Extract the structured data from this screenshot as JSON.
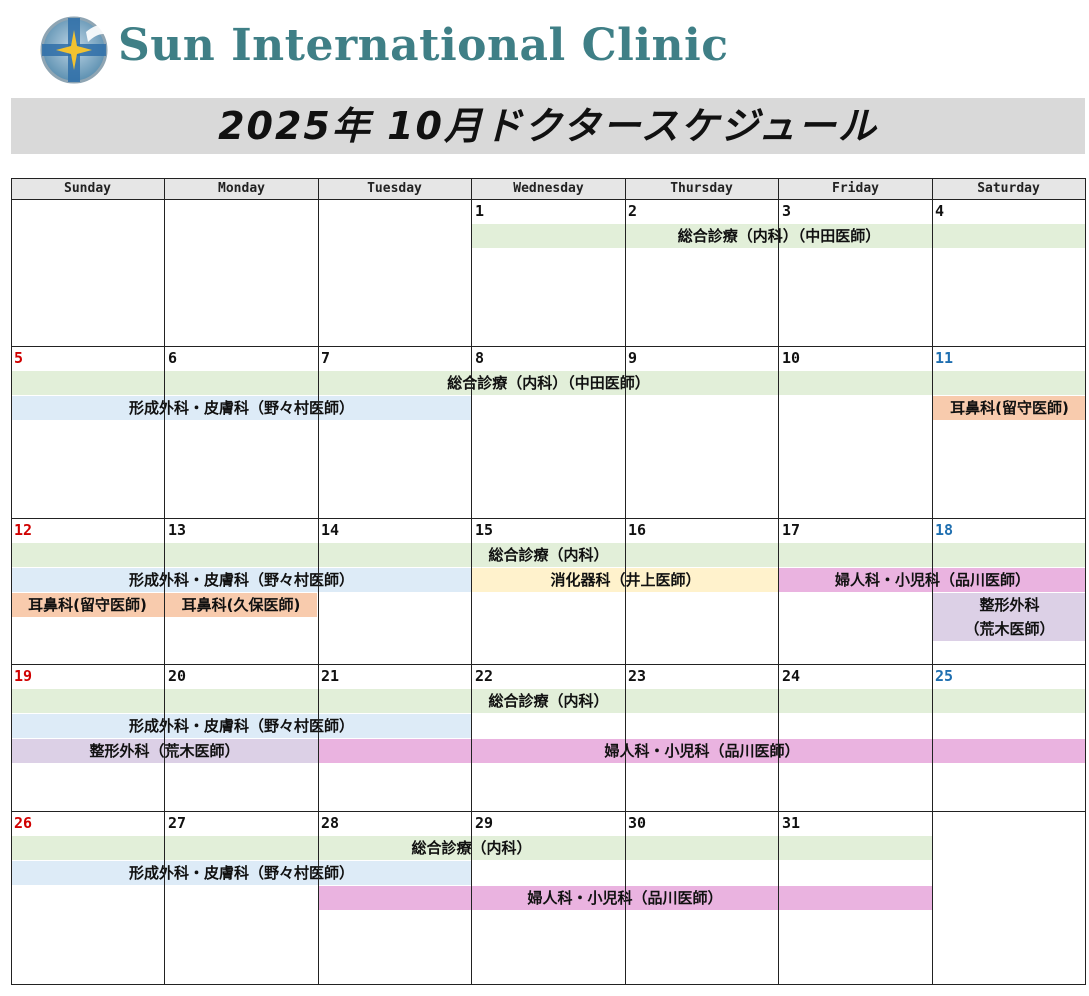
{
  "header": {
    "clinic_name": "Sun International Clinic",
    "logo_icon": "sun-star-logo-icon",
    "title": "2025年 10月ドクタースケジュール"
  },
  "calendar": {
    "weekdays": [
      "Sunday",
      "Monday",
      "Tuesday",
      "Wednesday",
      "Thursday",
      "Friday",
      "Saturday"
    ],
    "weeks": [
      [
        "",
        "",
        "",
        "1",
        "2",
        "3",
        "4"
      ],
      [
        "5",
        "6",
        "7",
        "8",
        "9",
        "10",
        "11"
      ],
      [
        "12",
        "13",
        "14",
        "15",
        "16",
        "17",
        "18"
      ],
      [
        "19",
        "20",
        "21",
        "22",
        "23",
        "24",
        "25"
      ],
      [
        "26",
        "27",
        "28",
        "29",
        "30",
        "31",
        ""
      ]
    ],
    "events": {
      "w1_general": "総合診療（内科）（中田医師）",
      "w2_general": "総合診療（内科）（中田医師）",
      "w2_plastic": "形成外科・皮膚科（野々村医師）",
      "w2_ent": "耳鼻科(留守医師)",
      "w3_general": "総合診療（内科）",
      "w3_plastic": "形成外科・皮膚科（野々村医師）",
      "w3_gastro": "消化器科（井上医師）",
      "w3_gyn": "婦人科・小児科（品川医師）",
      "w3_ent_sun": "耳鼻科(留守医師)",
      "w3_ent_mon": "耳鼻科(久保医師)",
      "w3_ortho_line1": "整形外科",
      "w3_ortho_line2": "（荒木医師）",
      "w4_general": "総合診療（内科）",
      "w4_plastic": "形成外科・皮膚科（野々村医師）",
      "w4_ortho": "整形外科（荒木医師）",
      "w4_gyn": "婦人科・小児科（品川医師）",
      "w5_general": "総合診療（内科）",
      "w5_plastic": "形成外科・皮膚科（野々村医師）",
      "w5_gyn": "婦人科・小児科（品川医師）"
    },
    "colors": {
      "general": "#e2efd9",
      "plastic": "#ddebf7",
      "ent": "#f8cbad",
      "gastro": "#fff2cc",
      "gyn": "#eab3e0",
      "ortho": "#dcd0e6",
      "sunday_number": "#d00000",
      "saturday_number": "#1f6fb0",
      "brand": "#3f7f86"
    }
  }
}
